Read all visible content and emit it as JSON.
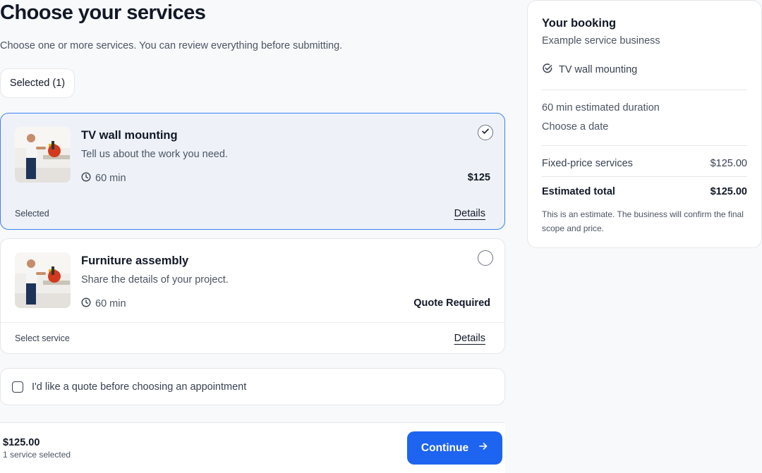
{
  "header": {
    "title": "Choose your services",
    "subtitle": "Choose one or more services. You can review everything before submitting.",
    "selected_chip": "Selected (1)"
  },
  "services": [
    {
      "name": "TV wall mounting",
      "description": "Tell us about the work you need.",
      "duration": "60 min",
      "price": "$125",
      "status": "Selected",
      "details_label": "Details",
      "selected": true
    },
    {
      "name": "Furniture assembly",
      "description": "Share the details of your project.",
      "duration": "60 min",
      "price": "Quote Required",
      "status": "Select service",
      "details_label": "Details",
      "selected": false
    }
  ],
  "quote_option": {
    "label": "I'd like a quote before choosing an appointment",
    "checked": false
  },
  "footer": {
    "total": "$125.00",
    "count": "1 service selected",
    "continue_label": "Continue"
  },
  "summary": {
    "title": "Your booking",
    "business": "Example service business",
    "items": [
      "TV wall mounting"
    ],
    "duration": "60 min estimated duration",
    "date_prompt": "Choose a date",
    "fixed_label": "Fixed-price services",
    "fixed_value": "$125.00",
    "total_label": "Estimated total",
    "total_value": "$125.00",
    "note": "This is an estimate. The business will confirm the final scope and price."
  },
  "icons": {
    "duration": "clock-icon",
    "selected": "check-icon",
    "summary_item": "check-circle-icon",
    "continue": "arrow-right-icon"
  },
  "colors": {
    "accent": "#1d64f0",
    "selected_border": "#3b82f6",
    "selected_bg": "#eef2f8"
  }
}
